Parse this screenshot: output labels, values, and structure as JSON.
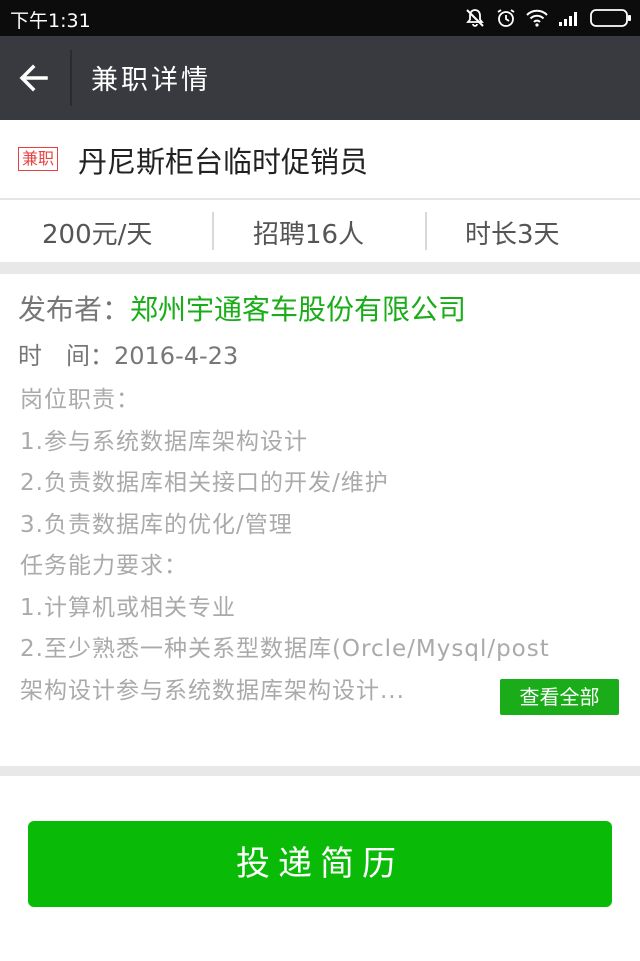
{
  "status_bar": {
    "time": "下午1:31"
  },
  "app_bar": {
    "title": "兼职详情"
  },
  "job": {
    "tag": "兼职",
    "title": "丹尼斯柜台临时促销员",
    "salary": "200元/天",
    "headcount": "招聘16人",
    "duration": "时长3天"
  },
  "publisher": {
    "label": "发布者：",
    "company": "郑州宇通客车股份有限公司",
    "date_label": "时　间：",
    "date": "2016-4-23"
  },
  "description": {
    "lines": [
      "岗位职责：",
      "1.参与系统数据库架构设计",
      "2.负责数据库相关接口的开发/维护",
      "3.负责数据库的优化/管理",
      "任务能力要求：",
      "1.计算机或相关专业",
      "2.至少熟悉一种关系型数据库(Orcle/Mysql/post",
      "架构设计参与系统数据库架构设计..."
    ],
    "view_all_label": "查看全部"
  },
  "actions": {
    "submit_label": "投递简历"
  },
  "colors": {
    "accent": "#1aad19",
    "button": "#09bb07",
    "tag": "#e64340",
    "app_bar": "#393a3f"
  }
}
